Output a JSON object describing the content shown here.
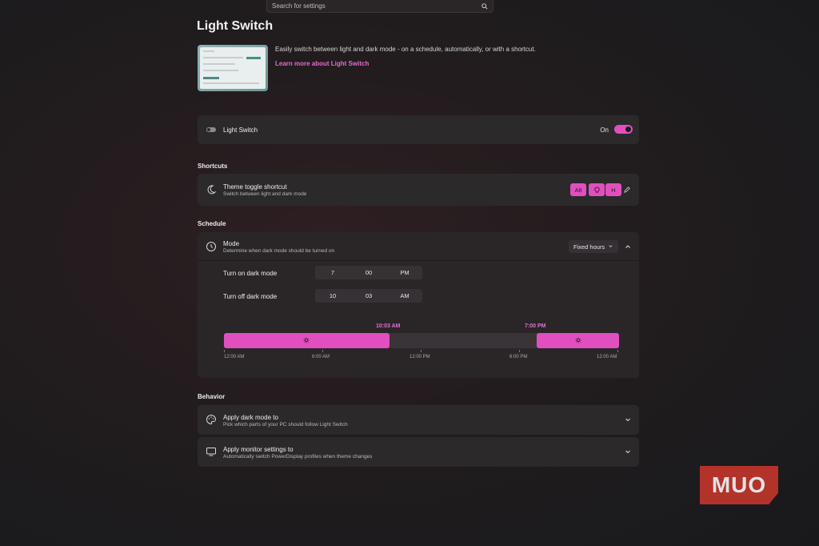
{
  "search": {
    "placeholder": "Search for settings"
  },
  "page": {
    "title": "Light Switch",
    "description": "Easily switch between light and dark mode - on a schedule, automatically, or with a shortcut.",
    "learn_more": "Learn more about Light Switch"
  },
  "enable": {
    "label": "Light Switch",
    "state": "On"
  },
  "shortcuts": {
    "section": "Shortcuts",
    "title": "Theme toggle shortcut",
    "subtitle": "Switch between light and dark mode",
    "keys": [
      "Alt",
      "⌘",
      "H"
    ]
  },
  "schedule": {
    "section": "Schedule",
    "mode_title": "Mode",
    "mode_subtitle": "Determine when dark mode should be turned on",
    "mode_value": "Fixed hours",
    "on_label": "Turn on dark mode",
    "on_time": {
      "hour": "7",
      "minute": "00",
      "period": "PM"
    },
    "off_label": "Turn off dark mode",
    "off_time": {
      "hour": "10",
      "minute": "03",
      "period": "AM"
    },
    "light_start_label": "10:03 AM",
    "dark_start_label": "7:00 PM",
    "ticks": [
      "12:00 AM",
      "6:00 AM",
      "12:00 PM",
      "6:00 PM",
      "12:00 AM"
    ]
  },
  "behavior": {
    "section": "Behavior",
    "apply_dark": {
      "title": "Apply dark mode to",
      "subtitle": "Pick which parts of your PC should follow Light Switch"
    },
    "apply_monitor": {
      "title": "Apply monitor settings to",
      "subtitle": "Automatically switch PowerDisplay profiles when theme changes"
    }
  },
  "watermark": "MUO",
  "colors": {
    "accent": "#e14fbf",
    "card": "#2c292b",
    "link": "#e36bd0"
  }
}
